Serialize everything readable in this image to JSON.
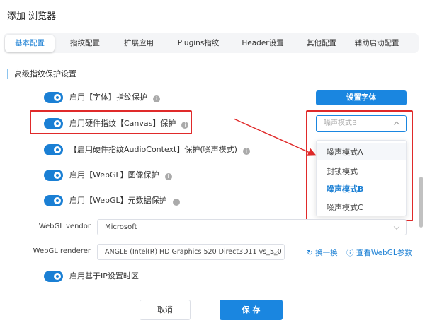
{
  "window": {
    "title": "添加 浏览器"
  },
  "tabs": [
    {
      "label": "基本配置",
      "active": true
    },
    {
      "label": "指纹配置"
    },
    {
      "label": "扩展应用"
    },
    {
      "label": "Plugins指纹"
    },
    {
      "label": "Header设置"
    },
    {
      "label": "其他配置"
    },
    {
      "label": "辅助启动配置"
    }
  ],
  "section": {
    "title": "高级指纹保护设置"
  },
  "toggles": [
    {
      "label": "启用【字体】指纹保护",
      "on": true
    },
    {
      "label": "启用硬件指纹【Canvas】保护",
      "on": true
    },
    {
      "label": "【启用硬件指纹AudioContext】保护(噪声模式)",
      "on": true
    },
    {
      "label": "启用【WebGL】图像保护",
      "on": true
    },
    {
      "label": "启用【WebGL】元数据保护",
      "on": true
    },
    {
      "label": "启用基于IP设置时区",
      "on": true
    }
  ],
  "font_button": "设置字体",
  "canvas_select": {
    "value": "噪声模式B",
    "options": [
      "噪声模式A",
      "封锁模式",
      "噪声模式B",
      "噪声模式C"
    ],
    "selected": "噪声模式B"
  },
  "webgl_vendor": {
    "label": "WebGL vendor",
    "value": "Microsoft"
  },
  "webgl_renderer": {
    "label": "WebGL renderer",
    "value": "ANGLE (Intel(R) HD Graphics 520 Direct3D11 vs_5_0 ps_5_0)",
    "refresh": "换一换",
    "view": "查看WebGL参数"
  },
  "footer": {
    "cancel": "取消",
    "save": "保 存"
  },
  "colors": {
    "accent": "#1a86e0",
    "highlight": "#e02a2a"
  }
}
